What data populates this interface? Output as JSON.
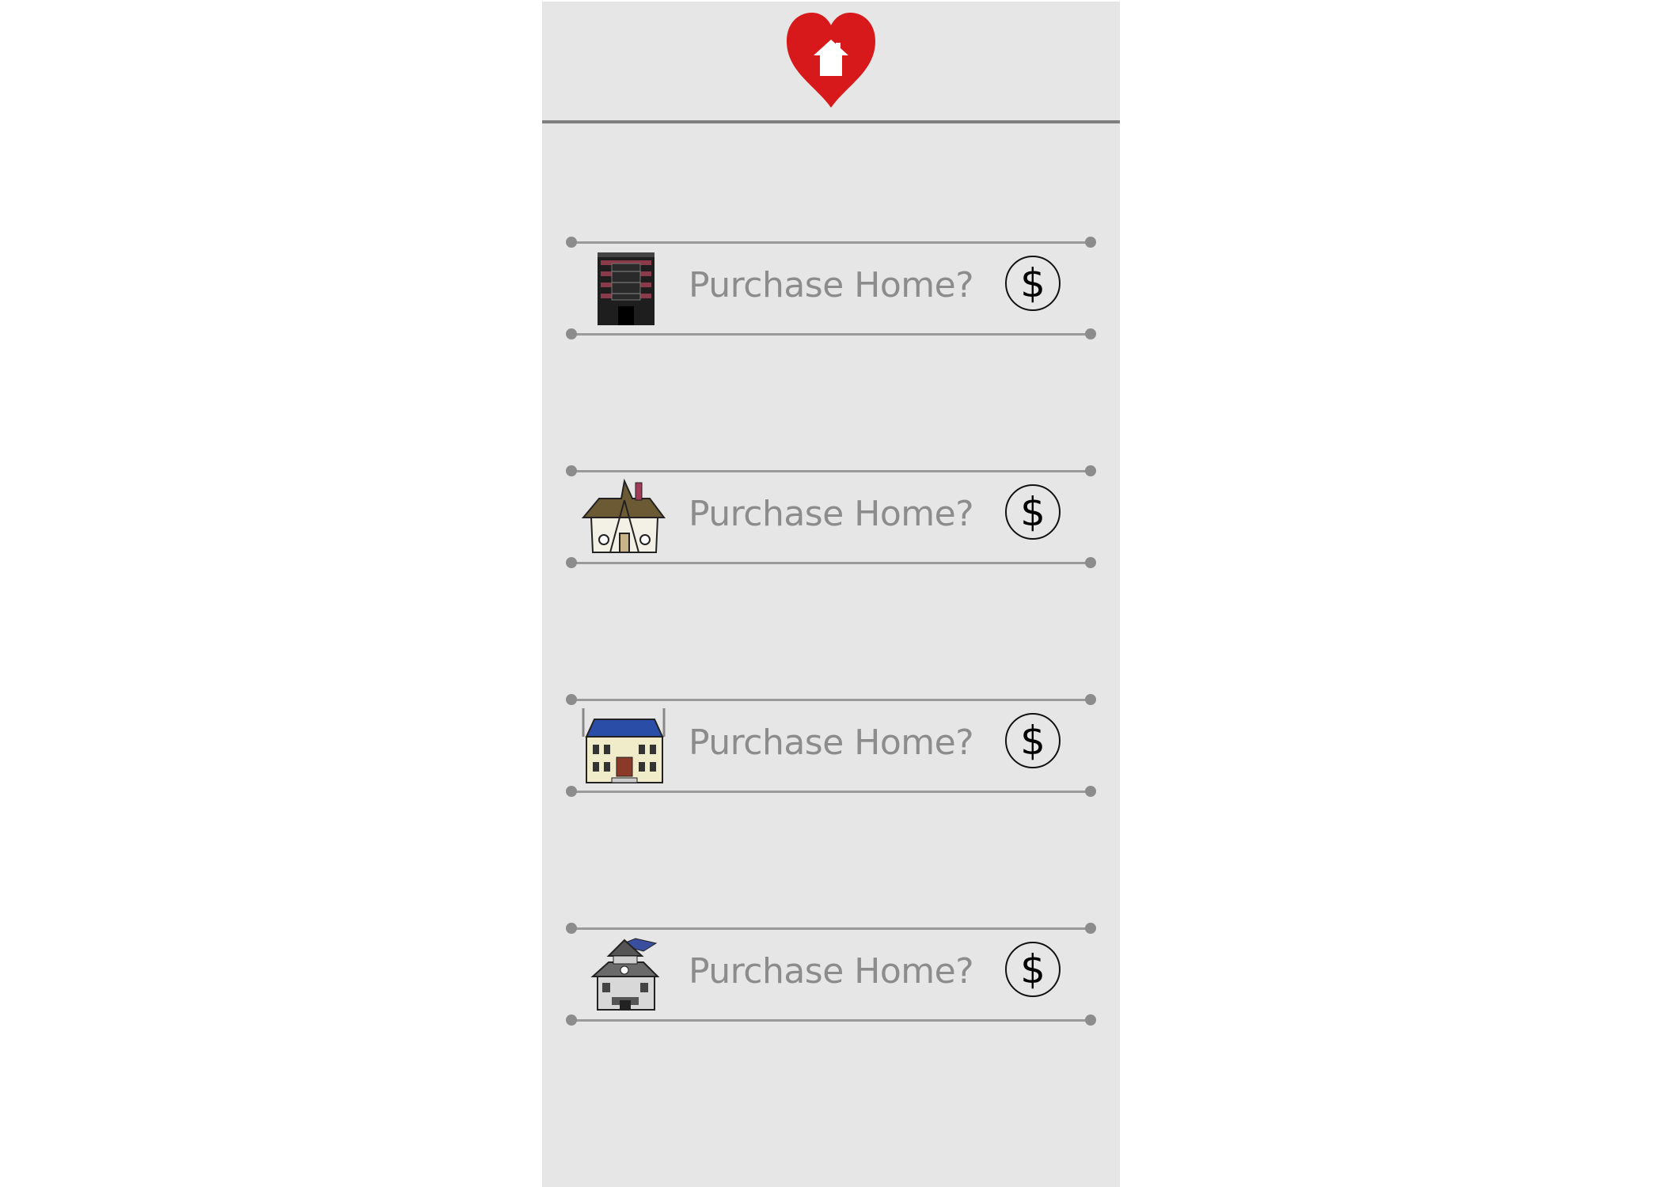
{
  "header": {
    "logo_icon": "heart-house-icon",
    "logo_color": "#d8191c"
  },
  "listings": [
    {
      "icon": "apartment-building-icon",
      "label": "Purchase Home?",
      "button_label": "$"
    },
    {
      "icon": "tudor-cottage-icon",
      "label": "Purchase Home?",
      "button_label": "$"
    },
    {
      "icon": "mansion-icon",
      "label": "Purchase Home?",
      "button_label": "$"
    },
    {
      "icon": "haunted-house-icon",
      "label": "Purchase Home?",
      "button_label": "$"
    }
  ],
  "colors": {
    "panel": "#e6e6e6",
    "label": "#8c8c8c",
    "rail": "#9a9a9a"
  }
}
